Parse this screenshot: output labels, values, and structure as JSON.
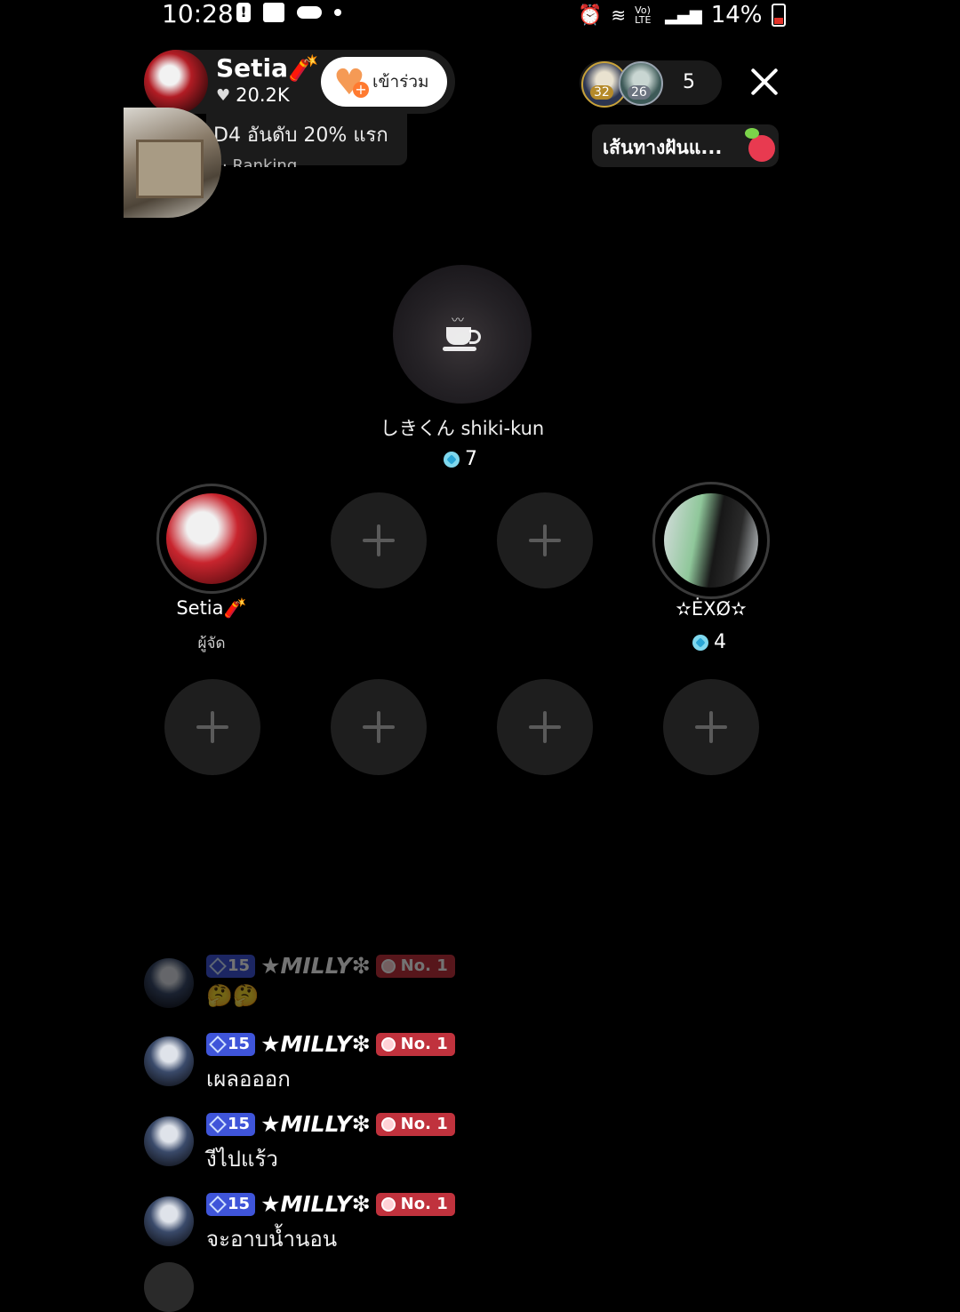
{
  "status_bar": {
    "time": "10:28",
    "alert_glyph": "!",
    "signal_label": "Vo) LTE",
    "battery_percent": "14%",
    "battery_color": "#e2332a"
  },
  "host": {
    "name": "Setia🧨",
    "likes": "20.2K",
    "join_label": "เข้าร่วม",
    "rank_text": "D4 อันดับ 20% แรก",
    "rank_sub": "· Ranking"
  },
  "viewers": {
    "avatar1_level": "32",
    "avatar2_level": "26",
    "count": "5"
  },
  "event": {
    "label": "เส้นทางฝันแ..."
  },
  "main_seat": {
    "name": "しきくん shiki-kun",
    "score": "7"
  },
  "seats": [
    {
      "name": "Setia🧨",
      "role": "ผู้จัด"
    },
    {
      "name": "✫ĖXØ✫",
      "score": "4"
    }
  ],
  "chat": [
    {
      "level": "15",
      "user": "★MILLY❇",
      "rank": "No. 1",
      "message": "🤔🤔"
    },
    {
      "level": "15",
      "user": "★MILLY❇",
      "rank": "No. 1",
      "message": "เผลอออก"
    },
    {
      "level": "15",
      "user": "★MILLY❇",
      "rank": "No. 1",
      "message": "งีไปแร้ว"
    },
    {
      "level": "15",
      "user": "★MILLY❇",
      "rank": "No. 1",
      "message": "จะอาบน้ำนอน"
    }
  ],
  "colors": {
    "level_badge": "#3f55d9",
    "rank_badge": "#c0323d",
    "gem": "#7fd8ee"
  }
}
